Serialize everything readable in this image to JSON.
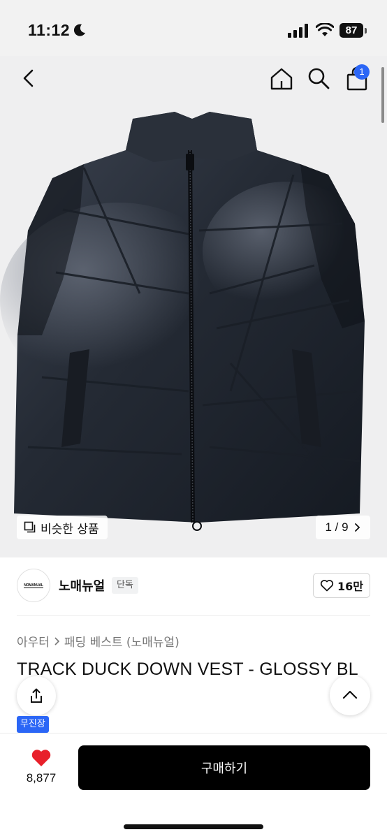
{
  "status_bar": {
    "time": "11:12",
    "battery": "87"
  },
  "hero": {
    "similar_products_label": "비슷한 상품",
    "page_counter": "1 / 9",
    "cart_count": "1"
  },
  "brand": {
    "logo_text": "NOMANUAL",
    "name": "노매뉴얼",
    "exclusive_label": "단독",
    "like_count": "16만"
  },
  "product": {
    "breadcrumb": [
      "아우터",
      "패딩 베스트 (노매뉴얼)"
    ],
    "title": "TRACK DUCK DOWN VEST - GLOSSY BL",
    "free_shipping_label": "무진장"
  },
  "bottom_bar": {
    "favorite_count": "8,877",
    "buy_label": "구매하기"
  },
  "colors": {
    "accent_blue": "#2b66f6",
    "heart_red": "#e8202a",
    "buy_button": "#000000"
  },
  "icons": [
    "moon-icon",
    "signal-icon",
    "wifi-icon",
    "back-icon",
    "home-icon",
    "search-icon",
    "shopping-bag-icon",
    "copy-icon",
    "chevron-right-icon",
    "heart-outline-icon",
    "share-icon",
    "chevron-up-icon",
    "heart-filled-icon"
  ]
}
